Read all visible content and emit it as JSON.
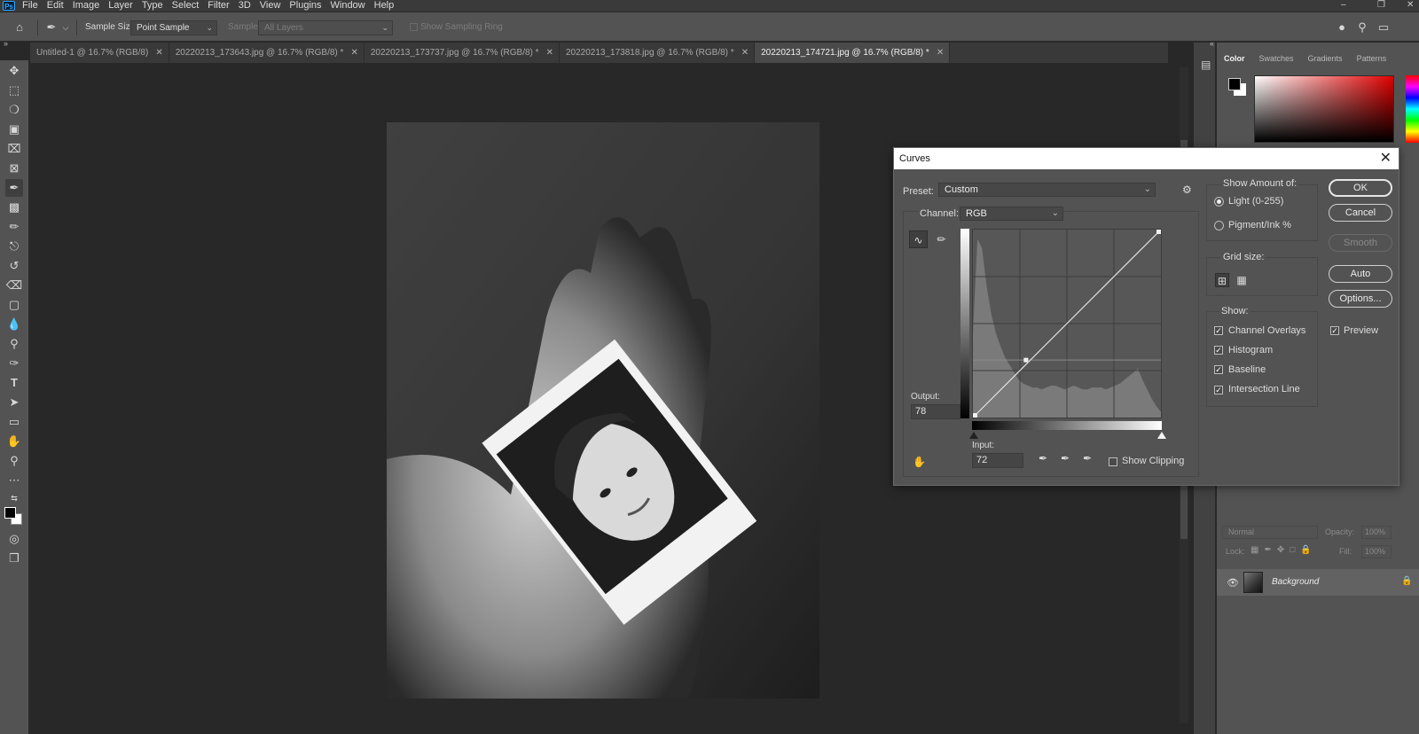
{
  "app": {
    "logo": "Ps"
  },
  "menu": [
    "File",
    "Edit",
    "Image",
    "Layer",
    "Type",
    "Select",
    "Filter",
    "3D",
    "View",
    "Plugins",
    "Window",
    "Help"
  ],
  "options_bar": {
    "sample_size_label": "Sample Size:",
    "sample_size_value": "Point Sample",
    "sample_label": "Sample:",
    "sample_value": "All Layers",
    "show_ring_label": "Show Sampling Ring"
  },
  "tabs": [
    {
      "label": "Untitled-1 @ 16.7% (RGB/8)",
      "active": false
    },
    {
      "label": "20220213_173643.jpg @ 16.7% (RGB/8) *",
      "active": false
    },
    {
      "label": "20220213_173737.jpg @ 16.7% (RGB/8) *",
      "active": false
    },
    {
      "label": "20220213_173818.jpg @ 16.7% (RGB/8) *",
      "active": false
    },
    {
      "label": "20220213_174721.jpg @ 16.7% (RGB/8) *",
      "active": true
    }
  ],
  "tools": [
    "move-icon",
    "marquee-icon",
    "lasso-icon",
    "object-select-icon",
    "crop-icon",
    "frame-icon",
    "eyedropper-icon",
    "healing-icon",
    "brush-icon",
    "stamp-icon",
    "history-brush-icon",
    "eraser-icon",
    "gradient-icon",
    "blur-icon",
    "dodge-icon",
    "pen-icon",
    "type-icon",
    "path-select-icon",
    "rectangle-icon",
    "hand-icon",
    "zoom-icon",
    "more-icon"
  ],
  "panel": {
    "tabs": [
      "Color",
      "Swatches",
      "Gradients",
      "Patterns"
    ],
    "active_tab": "Color"
  },
  "layers": {
    "blend_mode": "Normal",
    "opacity_label": "Opacity:",
    "opacity_value": "100%",
    "lock_label": "Lock:",
    "fill_label": "Fill:",
    "fill_value": "100%",
    "layer_name": "Background"
  },
  "curves": {
    "title": "Curves",
    "preset_label": "Preset:",
    "preset_value": "Custom",
    "channel_label": "Channel:",
    "channel_value": "RGB",
    "output_label": "Output:",
    "output_value": "78",
    "input_label": "Input:",
    "input_value": "72",
    "show_clipping_label": "Show Clipping",
    "show_amount_label": "Show Amount of:",
    "light_label": "Light  (0-255)",
    "pigment_label": "Pigment/Ink %",
    "grid_size_label": "Grid size:",
    "show_label": "Show:",
    "show_options": [
      {
        "label": "Channel Overlays",
        "checked": true
      },
      {
        "label": "Histogram",
        "checked": true
      },
      {
        "label": "Baseline",
        "checked": true
      },
      {
        "label": "Intersection Line",
        "checked": true
      }
    ],
    "buttons": {
      "ok": "OK",
      "cancel": "Cancel",
      "smooth": "Smooth",
      "auto": "Auto",
      "options": "Options..."
    },
    "preview_label": "Preview",
    "point": {
      "input": 72,
      "output": 78
    }
  }
}
